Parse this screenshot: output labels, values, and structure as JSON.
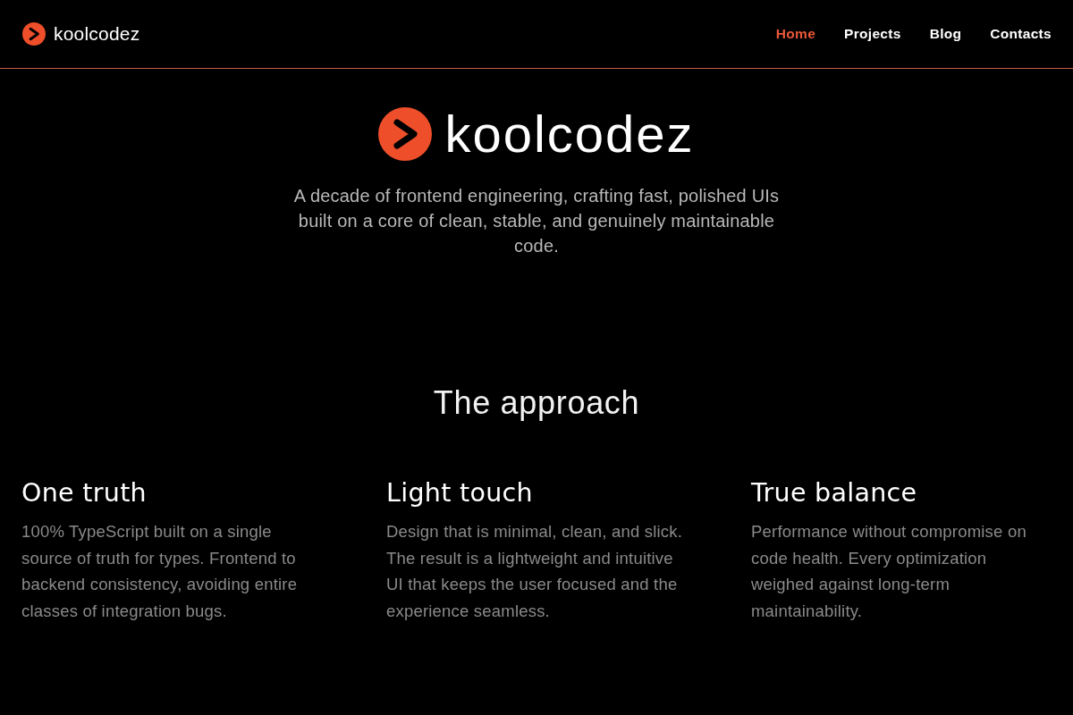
{
  "header": {
    "brand": "koolcodez",
    "nav": [
      {
        "label": "Home",
        "selected": true
      },
      {
        "label": "Projects",
        "selected": false
      },
      {
        "label": "Blog",
        "selected": false
      },
      {
        "label": "Contacts",
        "selected": false
      }
    ]
  },
  "hero": {
    "title": "koolcodez",
    "tagline": "A decade of frontend engineering, crafting fast, polished UIs built on a core of clean, stable, and genuinely maintainable code."
  },
  "approach": {
    "heading": "The approach",
    "items": [
      {
        "title": "One truth",
        "text": "100% TypeScript built on a single source of truth for types. Frontend to backend consistency, avoiding entire classes of integration bugs."
      },
      {
        "title": "Light touch",
        "text": "Design that is minimal, clean, and slick. The result is a lightweight and intuitive UI that keeps the user focused and the experience seamless."
      },
      {
        "title": "True balance",
        "text": "Performance without compromise on code health. Every optimization weighed against long-term maintainability."
      }
    ]
  }
}
